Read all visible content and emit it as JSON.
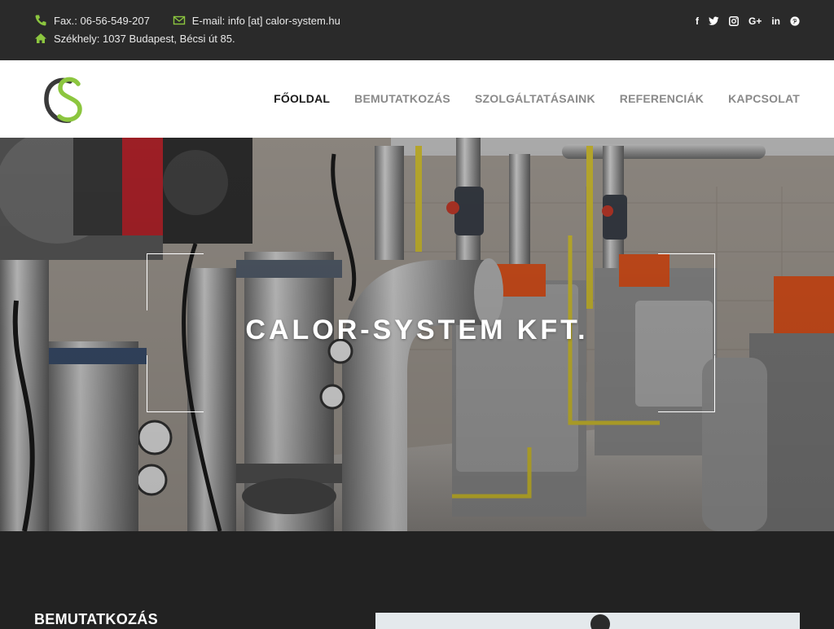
{
  "topbar": {
    "fax": "Fax.: 06-56-549-207",
    "email": "E-mail: info [at] calor-system.hu",
    "address": "Székhely: 1037 Budapest, Bécsi út 85.",
    "icons": [
      "phone-icon",
      "envelope-icon",
      "home-icon"
    ],
    "social": {
      "facebook": "f",
      "googleplus": "G+",
      "linkedin": "in"
    }
  },
  "nav": {
    "items": [
      {
        "label": "FŐOLDAL",
        "active": true
      },
      {
        "label": "BEMUTATKOZÁS",
        "active": false
      },
      {
        "label": "SZOLGÁLTATÁSAINK",
        "active": false
      },
      {
        "label": "REFERENCIÁK",
        "active": false
      },
      {
        "label": "KAPCSOLAT",
        "active": false
      }
    ]
  },
  "hero": {
    "title": "CALOR-SYSTEM KFT."
  },
  "section": {
    "heading": "BEMUTATKOZÁS"
  },
  "colors": {
    "accent": "#8cc63f",
    "topbar_bg": "#2a2a2a",
    "nav_bg": "#ffffff",
    "nav_text": "#8a8a8a",
    "nav_active": "#1a1a1a",
    "section_bg": "#222222"
  }
}
